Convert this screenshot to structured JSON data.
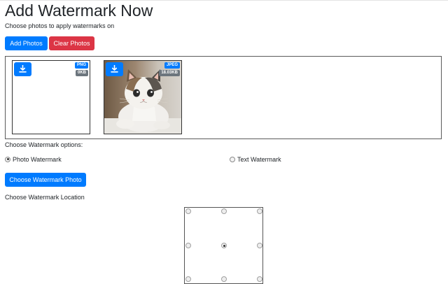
{
  "header": {
    "title": "Add Watermark Now",
    "subtitle": "Choose photos to apply watermarks on"
  },
  "toolbar": {
    "add_label": "Add Photos",
    "clear_label": "Clear Photos"
  },
  "photos": [
    {
      "type": "PNG",
      "size": "0KB",
      "has_image": false
    },
    {
      "type": "JPEG",
      "size": "18.03KB",
      "has_image": true
    }
  ],
  "watermark_options": {
    "label": "Choose Watermark options:",
    "options": [
      {
        "label": "Photo Watermark",
        "selected": true
      },
      {
        "label": "Text Watermark",
        "selected": false
      }
    ],
    "choose_photo_label": "Choose Watermark Photo"
  },
  "location": {
    "label": "Choose Watermark Location",
    "selected": "middle-center"
  },
  "colors": {
    "primary": "#007bff",
    "danger": "#dc3545",
    "badge_secondary": "#6c757d"
  },
  "icons": [
    "download-icon"
  ]
}
